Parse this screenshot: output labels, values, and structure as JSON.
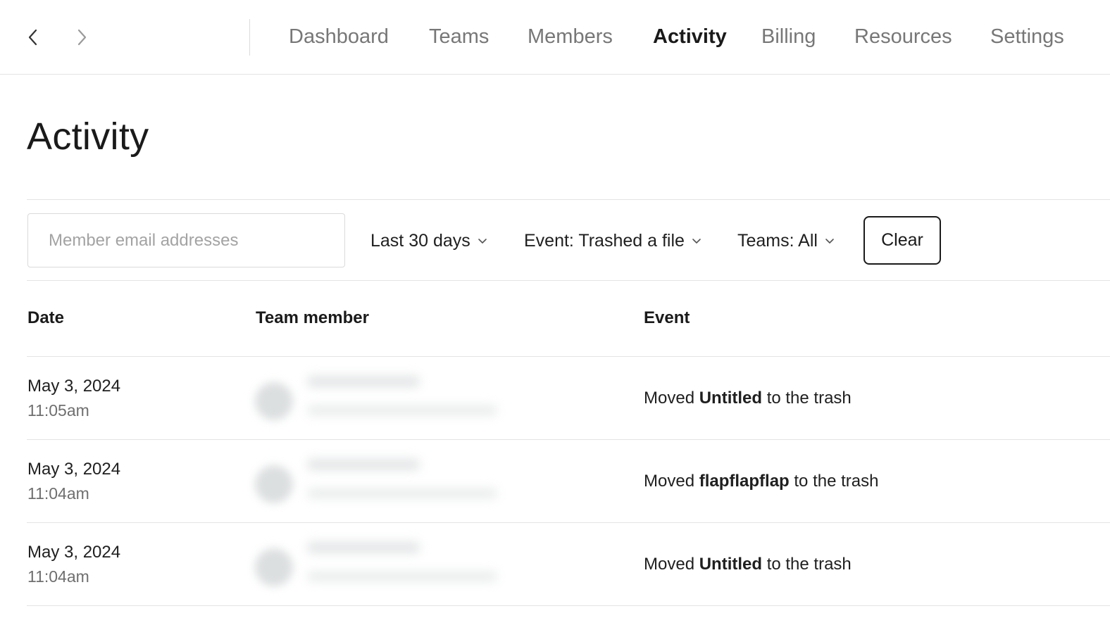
{
  "nav": {
    "back_icon": "chevron-left-icon",
    "forward_icon": "chevron-right-icon",
    "tabs": [
      {
        "label": "Dashboard",
        "active": false
      },
      {
        "label": "Teams",
        "active": false
      },
      {
        "label": "Members",
        "active": false
      },
      {
        "label": "Activity",
        "active": true
      },
      {
        "label": "Billing",
        "active": false
      },
      {
        "label": "Resources",
        "active": false
      },
      {
        "label": "Settings",
        "active": false
      }
    ]
  },
  "page": {
    "title": "Activity"
  },
  "filters": {
    "email_placeholder": "Member email addresses",
    "email_value": "",
    "date_range": "Last 30 days",
    "event": "Event: Trashed a file",
    "teams": "Teams: All",
    "clear_label": "Clear",
    "dropdown_icon": "chevron-down-icon"
  },
  "table": {
    "headers": {
      "date": "Date",
      "member": "Team member",
      "event": "Event"
    },
    "rows": [
      {
        "date": "May 3, 2024",
        "time": "11:05am",
        "event_prefix": "Moved ",
        "event_item": "Untitled",
        "event_suffix": " to the trash"
      },
      {
        "date": "May 3, 2024",
        "time": "11:04am",
        "event_prefix": "Moved ",
        "event_item": "flapflapflap",
        "event_suffix": " to the trash"
      },
      {
        "date": "May 3, 2024",
        "time": "11:04am",
        "event_prefix": "Moved ",
        "event_item": "Untitled",
        "event_suffix": " to the trash"
      }
    ]
  },
  "colors": {
    "text": "#1a1a1a",
    "muted_text": "#777777",
    "border": "#e4e4e4",
    "background": "#ffffff"
  }
}
